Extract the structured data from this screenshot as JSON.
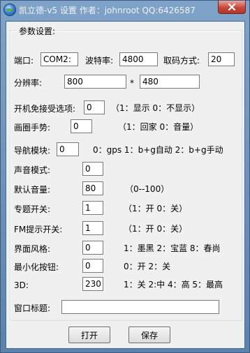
{
  "window": {
    "title": "凯立德-v5 设置 作者：johnroot QQ:6426587",
    "icon": "globe-icon",
    "close_icon": "close-icon"
  },
  "group": {
    "title": "参数设置:"
  },
  "port": {
    "label": "端口:",
    "value": "COM2:"
  },
  "baud": {
    "label": "波特率:",
    "value": "4800"
  },
  "code_mode": {
    "label": "取码方式:",
    "value": "20"
  },
  "resolution": {
    "label": "分辨率:",
    "width": "800",
    "separator": "*",
    "height": "480"
  },
  "boot_skip": {
    "label": "开机免接受选项:",
    "value": "0",
    "note": "（1：显示 0：不显示）"
  },
  "gesture": {
    "label": "画圈手势:",
    "value": "0",
    "note": "（1：回家 0：音量）"
  },
  "nav_module": {
    "label": "导航模块:",
    "value": "0",
    "note": "0：gps 1：b+g自动 2：b+g手动"
  },
  "sound_mode": {
    "label": "声音模式:",
    "value": "0"
  },
  "default_volume": {
    "label": "默认音量:",
    "value": "80",
    "note": "（0--100）"
  },
  "theme_switch": {
    "label": "专题开关:",
    "value": "1",
    "note": "（1：开 0：关）"
  },
  "fm_switch": {
    "label": "FM提示开关:",
    "value": "1",
    "note": "（1：开 0：关）"
  },
  "ui_style": {
    "label": "界面风格:",
    "value": "0",
    "note": "1：墨黑 2：宝蓝 8：春尚"
  },
  "minimize_btn": {
    "label": "最小化按钮:",
    "value": "0",
    "note": "0：开 2：关"
  },
  "three_d": {
    "label": "3D:",
    "value": "230",
    "note": "1：关 2:中 4：高 5：最高"
  },
  "window_title": {
    "label": "窗口标题:",
    "value": ""
  },
  "buttons": {
    "open": "打开",
    "save": "保存"
  },
  "colors": {
    "titlebar": "#6b8fb5",
    "close": "#c8473a",
    "client": "#f0f0f0"
  }
}
